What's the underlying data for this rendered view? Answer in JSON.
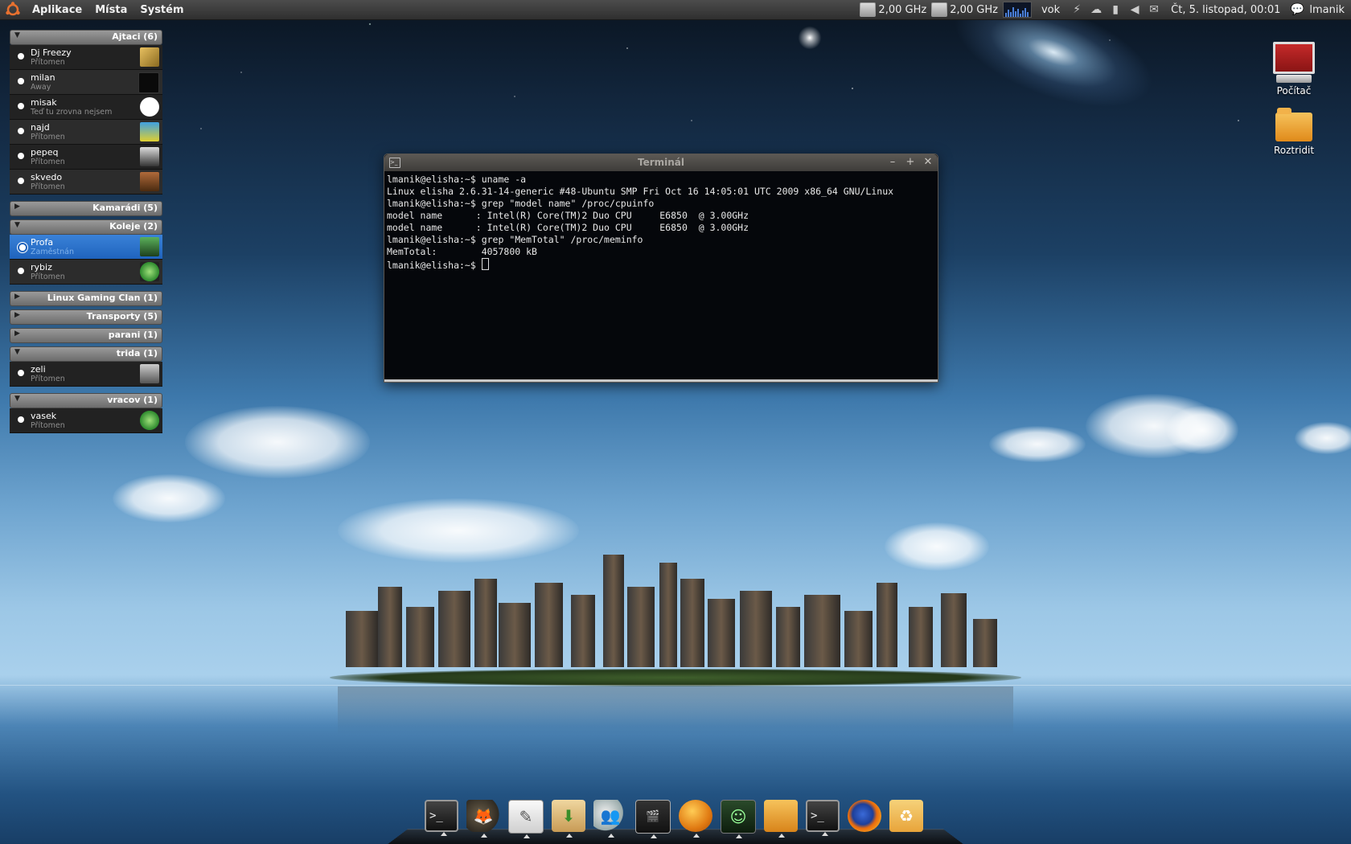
{
  "top_panel": {
    "menus": [
      "Aplikace",
      "Místa",
      "Systém"
    ],
    "cpu1": "2,00 GHz",
    "cpu2": "2,00 GHz",
    "user_status": "vok",
    "clock": "Čt, 5. listopad, 00:01",
    "user": "lmanik"
  },
  "buddy_list": {
    "groups": [
      {
        "name": "Ajtaci (6)",
        "expanded": true,
        "buddies": [
          {
            "name": "Dj Freezy",
            "status": "Přítomen"
          },
          {
            "name": "milan",
            "status": "Away"
          },
          {
            "name": "misak",
            "status": "Teď tu zrovna nejsem"
          },
          {
            "name": "najd",
            "status": "Přítomen"
          },
          {
            "name": "pepeq",
            "status": "Přítomen"
          },
          {
            "name": "skvedo",
            "status": "Přítomen"
          }
        ]
      },
      {
        "name": "Kamarádi (5)",
        "expanded": false
      },
      {
        "name": "Koleje (2)",
        "expanded": true,
        "buddies": [
          {
            "name": "Profa",
            "status": "Zaměstnán",
            "selected": true
          },
          {
            "name": "rybiz",
            "status": "Přítomen"
          }
        ]
      },
      {
        "name": "Linux Gaming Clan (1)",
        "expanded": false
      },
      {
        "name": "Transporty (5)",
        "expanded": false
      },
      {
        "name": "parani (1)",
        "expanded": false
      },
      {
        "name": "trida (1)",
        "expanded": true,
        "buddies": [
          {
            "name": "zeli",
            "status": "Přítomen"
          }
        ]
      },
      {
        "name": "vracov (1)",
        "expanded": true,
        "buddies": [
          {
            "name": "vasek",
            "status": "Přítomen"
          }
        ]
      }
    ]
  },
  "desktop_icons": {
    "computer": "Počítač",
    "folder": "Roztridit"
  },
  "terminal": {
    "title": "Terminál",
    "lines": [
      "lmanik@elisha:~$ uname -a",
      "Linux elisha 2.6.31-14-generic #48-Ubuntu SMP Fri Oct 16 14:05:01 UTC 2009 x86_64 GNU/Linux",
      "lmanik@elisha:~$ grep \"model name\" /proc/cpuinfo",
      "model name      : Intel(R) Core(TM)2 Duo CPU     E6850  @ 3.00GHz",
      "model name      : Intel(R) Core(TM)2 Duo CPU     E6850  @ 3.00GHz",
      "lmanik@elisha:~$ grep \"MemTotal\" /proc/meminfo",
      "MemTotal:        4057800 kB"
    ],
    "prompt": "lmanik@elisha:~$ "
  },
  "dock": {
    "items": [
      "terminal-icon",
      "gimp-icon",
      "text-editor-icon",
      "archive-icon",
      "contacts-icon",
      "movie-clapper-icon",
      "globe-icon",
      "avatar-face-icon",
      "folder-icon",
      "terminal-icon",
      "firefox-icon",
      "recycle-icon"
    ]
  }
}
